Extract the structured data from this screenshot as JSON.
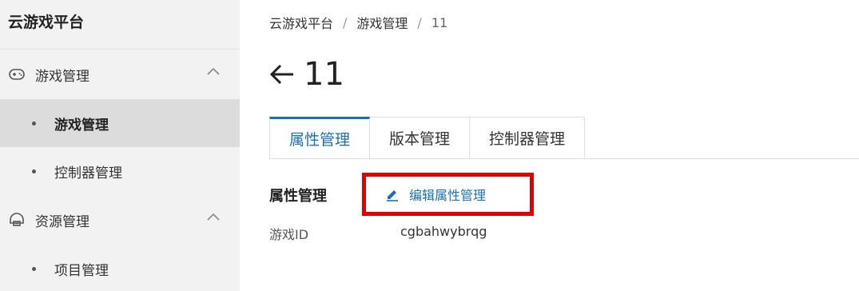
{
  "sidebar": {
    "brand": "云游戏平台",
    "groups": [
      {
        "label": "游戏管理",
        "icon": "gamepad-icon",
        "items": [
          {
            "label": "游戏管理",
            "active": true
          },
          {
            "label": "控制器管理",
            "active": false
          }
        ]
      },
      {
        "label": "资源管理",
        "icon": "resource-icon",
        "items": [
          {
            "label": "项目管理",
            "active": false
          }
        ]
      }
    ]
  },
  "breadcrumb": [
    "云游戏平台",
    "游戏管理",
    "11"
  ],
  "breadcrumb_sep": "/",
  "page": {
    "title": "11"
  },
  "tabs": [
    {
      "label": "属性管理",
      "active": true
    },
    {
      "label": "版本管理",
      "active": false
    },
    {
      "label": "控制器管理",
      "active": false
    }
  ],
  "section": {
    "title": "属性管理",
    "edit_label": "编辑属性管理",
    "fields": [
      {
        "label": "游戏ID",
        "value": "cgbahwybrqg"
      }
    ]
  },
  "colors": {
    "accent": "#1a6fb6",
    "highlight_border": "#e00000",
    "sidebar_bg": "#f2f2f2",
    "active_item_bg": "#dcdcdc"
  }
}
